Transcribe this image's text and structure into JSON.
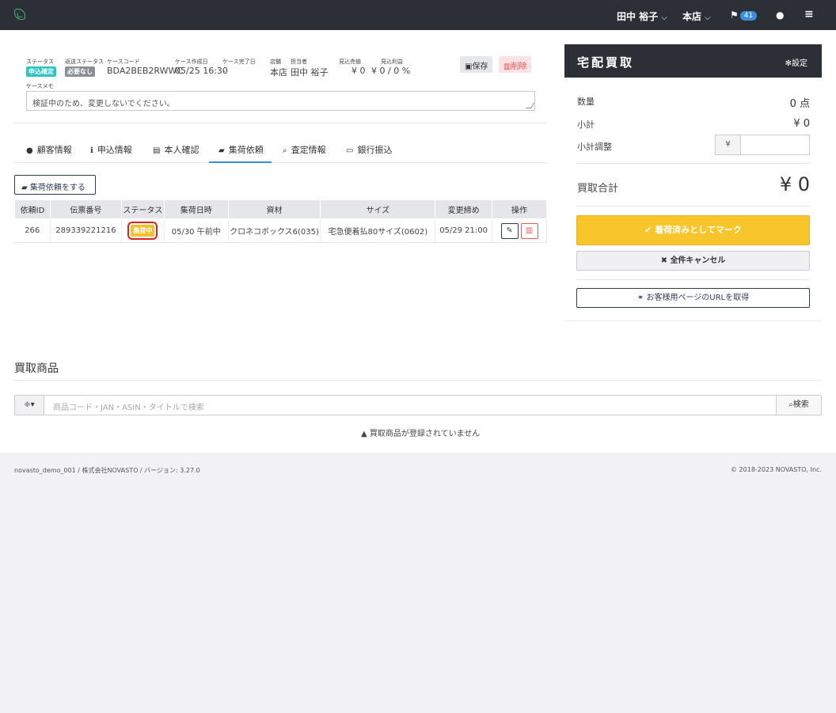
{
  "topbar": {
    "user": "田中 裕子",
    "store": "本店",
    "notif_count": "41"
  },
  "case": {
    "labels": {
      "status": "ステータス",
      "ship_status": "返送ステータス",
      "case_code": "ケースコード",
      "created": "ケース作成日",
      "completed": "ケース完了日",
      "store": "店舗",
      "staff": "担当者",
      "est_sale": "見込売値",
      "est_profit": "見込利益",
      "memo": "ケースメモ"
    },
    "status_badge": "申込確定",
    "ship_badge": "必要なし",
    "case_code": "BDA2BEB2RWWC",
    "created": "05/25 16:30",
    "completed": "-",
    "store": "本店",
    "staff": "田中 裕子",
    "est_sale": "¥ 0",
    "est_profit": "¥ 0 / 0 %",
    "memo": "検証中のため、変更しないでください。",
    "save_label": "保存",
    "delete_label": "削除"
  },
  "tabs": [
    {
      "label": "顧客情報"
    },
    {
      "label": "申込情報"
    },
    {
      "label": "本人確認"
    },
    {
      "label": "集荷依頼"
    },
    {
      "label": "査定情報"
    },
    {
      "label": "銀行振込"
    }
  ],
  "pickup": {
    "request_button": "集荷依頼をする",
    "columns": [
      "依頼ID",
      "伝票番号",
      "ステータス",
      "集荷日時",
      "資材",
      "サイズ",
      "変更締め",
      "操作"
    ],
    "rows": [
      {
        "id": "266",
        "slip": "289339221216",
        "status": "集荷中",
        "datetime": "05/30 午前中",
        "material": "クロネコボックス6(035)",
        "size": "宅急便着払80サイズ(0602)",
        "deadline": "05/29 21:00"
      }
    ]
  },
  "side": {
    "title": "宅配買取",
    "settings": "設定",
    "qty_label": "数量",
    "qty_value": "0 点",
    "subtotal_label": "小計",
    "subtotal_value": "¥ 0",
    "adjust_label": "小計調整",
    "adjust_prefix": "¥",
    "total_label": "買取合計",
    "total_value": "¥ 0",
    "mark_button": "着荷済みとしてマーク",
    "cancel_button": "全件キャンセル",
    "url_button": "お客様用ページのURLを取得"
  },
  "items": {
    "title": "買取商品",
    "search_placeholder": "商品コード・JAN・ASIN・タイトルで検索",
    "search_button": "検索",
    "empty": "買取商品が登録されていません"
  },
  "footer": {
    "left": "novasto_demo_001 / 株式会社NOVASTO / バージョン: 3.27.0",
    "right": "© 2018-2023 NOVASTO, Inc."
  },
  "colors": {
    "topbar": "#2c3036",
    "accent_blue": "#3a8fd6",
    "status_teal": "#2cc3c7",
    "badge_gray": "#8a8f97",
    "mark_yellow": "#f8c52b",
    "danger": "#e35c5c"
  }
}
